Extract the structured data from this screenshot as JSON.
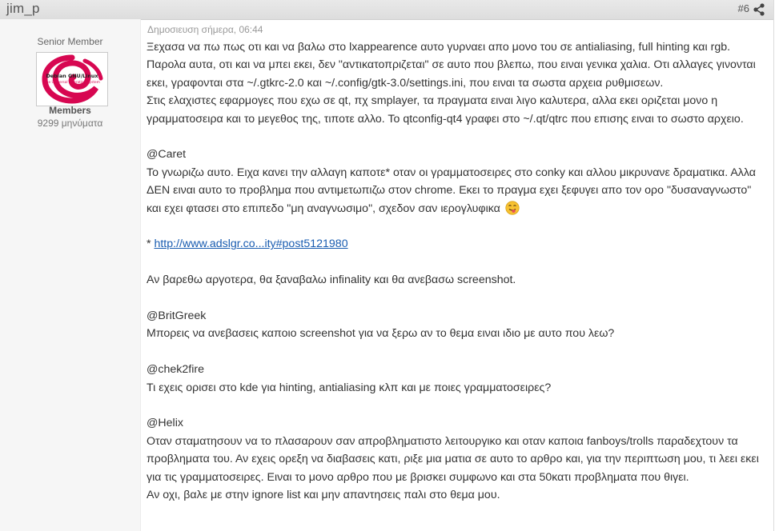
{
  "header": {
    "username": "jim_p",
    "post_number": "#6"
  },
  "sidebar": {
    "rank": "Senior Member",
    "avatar_text": {
      "line1": "Debian GNU/Linux",
      "line2": "The Universal Operating System"
    },
    "group": "Members",
    "post_count": "9299 μηνύματα"
  },
  "post": {
    "date": "Δημοσιευση σήμερα, 06:44",
    "paragraphs": [
      [
        "Ξεχασα να πω πως οτι και να βαλω στο lxappearence αυτο γυρναει απο μονο του σε antialiasing, full hinting και rgb.",
        "Παρολα αυτα, οτι και να μπει εκει, δεν \"αντικατοπριζεται\" σε αυτο που βλεπω, που ειναι γενικα χαλια. Οτι αλλαγες γινονται",
        "εκει, γραφονται στα ~/.gtkrc-2.0 και ~/.config/gtk-3.0/settings.ini, που ειναι τα σωστα αρχεια ρυθμισεων.",
        "Στις ελαχιστες εφαρμογες που εχω σε qt, πχ smplayer, τα πραγματα ειναι λιγο καλυτερα, αλλα εκει οριζεται μονο η",
        "γραμματοσειρα και το μεγεθος της, τιποτε αλλο. Το qtconfig-qt4 γραφει στο ~/.qt/qtrc που επισης ειναι το σωστο αρχειο."
      ],
      [
        "@Caret",
        "Το γνωριζω αυτο. Ειχα κανει την αλλαγη καποτε* οταν οι γραμματοσειρες στο conky και αλλου μικρυνανε δραματικα. Αλλα",
        "ΔΕΝ ειναι αυτο το προβλημα που αντιμετωπιζω στον chrome. Εκει το πραγμα εχει ξεφυγει απο τον ορο \"δυσαναγνωστο\"",
        "και εχει φτασει στο επιπεδο \"μη αναγνωσιμο\", σχεδον σαν ιερογλυφικα"
      ]
    ],
    "footnote_prefix": "* ",
    "footnote_link": "http://www.adslgr.co...ity#post5121980",
    "later_text": "Αν βαρεθω αργοτερα, θα ξαναβαλω infinality και θα ανεβασω screenshot.",
    "replies": [
      {
        "mention": "@BritGreek",
        "lines": [
          "Μπορεις να ανεβασεις καποιο screenshot για να ξερω αν το θεμα ειναι ιδιο με αυτο που λεω?"
        ]
      },
      {
        "mention": "@chek2fire",
        "lines": [
          "Τι εχεις ορισει στο kde για hinting, antialiasing κλπ και με ποιες γραμματοσειρες?"
        ]
      },
      {
        "mention": "@Helix",
        "lines": [
          "Οταν σταματησουν να το πλασαρουν σαν απροβληματιστο λειτουργικο και οταν καποια fanboys/trolls παραδεχτουν τα",
          "προβληματα του. Αν εχεις ορεξη να διαβασεις κατι, ριξε μια ματια σε αυτο το αρθρο και, για την περιπτωση μου, τι λεει εκει",
          "για τις γραμματοσειρες. Ειναι το μονο αρθρο που με βρισκει συμφωνο και στα 50κατι προβληματα που θιγει.",
          "Αν οχι, βαλε με στην ignore list και μην απαντησεις παλι στο θεμα μου."
        ]
      }
    ],
    "emoji": "tongue-out-emoji"
  },
  "colors": {
    "header_bg": "#e2e2e2",
    "sidebar_bg": "#f6f6f6",
    "text": "#333333",
    "link": "#1a5db1",
    "debian_red": "#d70751"
  }
}
